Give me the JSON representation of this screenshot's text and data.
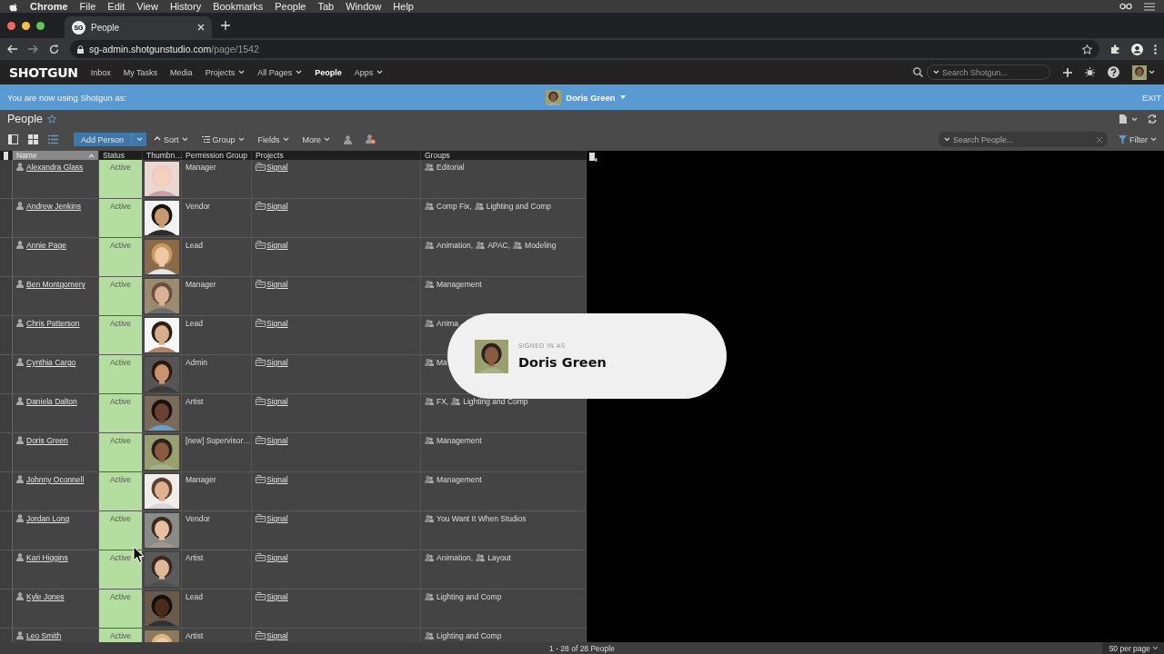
{
  "menubar": {
    "items": [
      "Chrome",
      "File",
      "Edit",
      "View",
      "History",
      "Bookmarks",
      "People",
      "Tab",
      "Window",
      "Help"
    ]
  },
  "browser": {
    "tab": {
      "favicon": "SG",
      "title": "People"
    },
    "url": {
      "host": "sg-admin.shotgunstudio.com",
      "path": "/page/1542"
    }
  },
  "nav": {
    "logo": "SHOTGUN",
    "items": [
      {
        "label": "Inbox",
        "dropdown": false,
        "selected": false
      },
      {
        "label": "My Tasks",
        "dropdown": false,
        "selected": false
      },
      {
        "label": "Media",
        "dropdown": false,
        "selected": false
      },
      {
        "label": "Projects",
        "dropdown": true,
        "selected": false
      },
      {
        "label": "All Pages",
        "dropdown": true,
        "selected": false
      },
      {
        "label": "People",
        "dropdown": false,
        "selected": true
      },
      {
        "label": "Apps",
        "dropdown": true,
        "selected": false
      }
    ],
    "search": {
      "placeholder": "Search Shotgun..."
    }
  },
  "banner": {
    "text": "You are now using Shotgun as:",
    "user": "Doris Green",
    "exit": "EXIT"
  },
  "page": {
    "title": "People"
  },
  "toolbar": {
    "views": [
      {
        "selected": false
      },
      {
        "selected": false
      },
      {
        "selected": true
      }
    ],
    "add_button": "Add Person",
    "menus": [
      "Sort",
      "Group",
      "Fields",
      "More"
    ],
    "search": {
      "placeholder": "Search People..."
    },
    "filter": "Filter"
  },
  "table": {
    "select_all": {
      "checked": false
    },
    "columns": [
      {
        "label": "Name",
        "sorted": true
      },
      {
        "label": "Status",
        "sorted": false
      },
      {
        "label": "Thumbn…",
        "sorted": false
      },
      {
        "label": "Permission Group",
        "sorted": false
      },
      {
        "label": "Projects",
        "sorted": false
      },
      {
        "label": "Groups",
        "sorted": false
      }
    ],
    "rows": [
      {
        "name": "Alexandra Glass",
        "status": "Active",
        "permission": "Manager",
        "project": "Signal",
        "groups": [
          "Editorial"
        ]
      },
      {
        "name": "Andrew Jenkins",
        "status": "Active",
        "permission": "Vendor",
        "project": "Signal",
        "groups": [
          "Comp Fix,",
          "Lighting and Comp"
        ]
      },
      {
        "name": "Annie Page",
        "status": "Active",
        "permission": "Lead",
        "project": "Signal",
        "groups": [
          "Animation,",
          "APAC,",
          "Modeling"
        ]
      },
      {
        "name": "Ben Montgomery",
        "status": "Active",
        "permission": "Manager",
        "project": "Signal",
        "groups": [
          "Management"
        ]
      },
      {
        "name": "Chris Patterson",
        "status": "Active",
        "permission": "Lead",
        "project": "Signal",
        "groups": [
          "Anima"
        ]
      },
      {
        "name": "Cynthia Cargo",
        "status": "Active",
        "permission": "Admin",
        "project": "Signal",
        "groups": [
          "Ma"
        ]
      },
      {
        "name": "Daniela Dalton",
        "status": "Active",
        "permission": "Artist",
        "project": "Signal",
        "groups": [
          "FX,",
          "Lighting and Comp"
        ]
      },
      {
        "name": "Doris Green",
        "status": "Active",
        "permission": "[new] Supervisor…",
        "project": "Signal",
        "groups": [
          "Management"
        ]
      },
      {
        "name": "Johnny Oconnell",
        "status": "Active",
        "permission": "Manager",
        "project": "Signal",
        "groups": [
          "Management"
        ]
      },
      {
        "name": "Jordan Long",
        "status": "Active",
        "permission": "Vendor",
        "project": "Signal",
        "groups": [
          "You Want It When Studios"
        ]
      },
      {
        "name": "Kari Higgins",
        "status": "Active",
        "permission": "Artist",
        "project": "Signal",
        "groups": [
          "Animation,",
          "Layout"
        ]
      },
      {
        "name": "Kyle Jones",
        "status": "Active",
        "permission": "Lead",
        "project": "Signal",
        "groups": [
          "Lighting and Comp"
        ]
      },
      {
        "name": "Leo Smith",
        "status": "Active",
        "permission": "Artist",
        "project": "Signal",
        "groups": [
          "Lighting and Comp"
        ]
      }
    ]
  },
  "footer": {
    "count": "1 - 28 of 28 People",
    "per_page": "50 per page"
  },
  "toast": {
    "label": "SIGNED IN AS",
    "name": "Doris Green"
  }
}
